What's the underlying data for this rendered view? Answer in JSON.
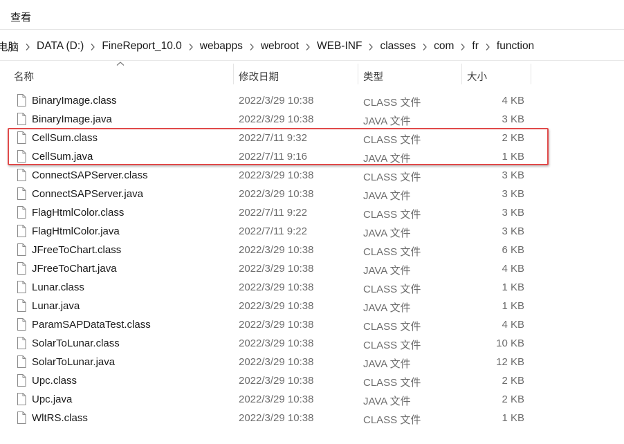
{
  "ribbon": {
    "view_tab": "查看"
  },
  "breadcrumb": [
    "电脑",
    "DATA (D:)",
    "FineReport_10.0",
    "webapps",
    "webroot",
    "WEB-INF",
    "classes",
    "com",
    "fr",
    "function"
  ],
  "columns": {
    "name": "名称",
    "date": "修改日期",
    "type": "类型",
    "size": "大小"
  },
  "files": [
    {
      "name": "BinaryImage.class",
      "date": "2022/3/29 10:38",
      "type": "CLASS 文件",
      "size": "4 KB"
    },
    {
      "name": "BinaryImage.java",
      "date": "2022/3/29 10:38",
      "type": "JAVA 文件",
      "size": "3 KB"
    },
    {
      "name": "CellSum.class",
      "date": "2022/7/11 9:32",
      "type": "CLASS 文件",
      "size": "2 KB"
    },
    {
      "name": "CellSum.java",
      "date": "2022/7/11 9:16",
      "type": "JAVA 文件",
      "size": "1 KB"
    },
    {
      "name": "ConnectSAPServer.class",
      "date": "2022/3/29 10:38",
      "type": "CLASS 文件",
      "size": "3 KB"
    },
    {
      "name": "ConnectSAPServer.java",
      "date": "2022/3/29 10:38",
      "type": "JAVA 文件",
      "size": "3 KB"
    },
    {
      "name": "FlagHtmlColor.class",
      "date": "2022/7/11 9:22",
      "type": "CLASS 文件",
      "size": "3 KB"
    },
    {
      "name": "FlagHtmlColor.java",
      "date": "2022/7/11 9:22",
      "type": "JAVA 文件",
      "size": "3 KB"
    },
    {
      "name": "JFreeToChart.class",
      "date": "2022/3/29 10:38",
      "type": "CLASS 文件",
      "size": "6 KB"
    },
    {
      "name": "JFreeToChart.java",
      "date": "2022/3/29 10:38",
      "type": "JAVA 文件",
      "size": "4 KB"
    },
    {
      "name": "Lunar.class",
      "date": "2022/3/29 10:38",
      "type": "CLASS 文件",
      "size": "1 KB"
    },
    {
      "name": "Lunar.java",
      "date": "2022/3/29 10:38",
      "type": "JAVA 文件",
      "size": "1 KB"
    },
    {
      "name": "ParamSAPDataTest.class",
      "date": "2022/3/29 10:38",
      "type": "CLASS 文件",
      "size": "4 KB"
    },
    {
      "name": "SolarToLunar.class",
      "date": "2022/3/29 10:38",
      "type": "CLASS 文件",
      "size": "10 KB"
    },
    {
      "name": "SolarToLunar.java",
      "date": "2022/3/29 10:38",
      "type": "JAVA 文件",
      "size": "12 KB"
    },
    {
      "name": "Upc.class",
      "date": "2022/3/29 10:38",
      "type": "CLASS 文件",
      "size": "2 KB"
    },
    {
      "name": "Upc.java",
      "date": "2022/3/29 10:38",
      "type": "JAVA 文件",
      "size": "2 KB"
    },
    {
      "name": "WltRS.class",
      "date": "2022/3/29 10:38",
      "type": "CLASS 文件",
      "size": "1 KB"
    }
  ],
  "colors": {
    "highlight_border": "#e04a4a"
  },
  "icons": {
    "file": "blank-file-icon",
    "separator": "chevron-right-icon",
    "sort": "sort-up-icon"
  }
}
